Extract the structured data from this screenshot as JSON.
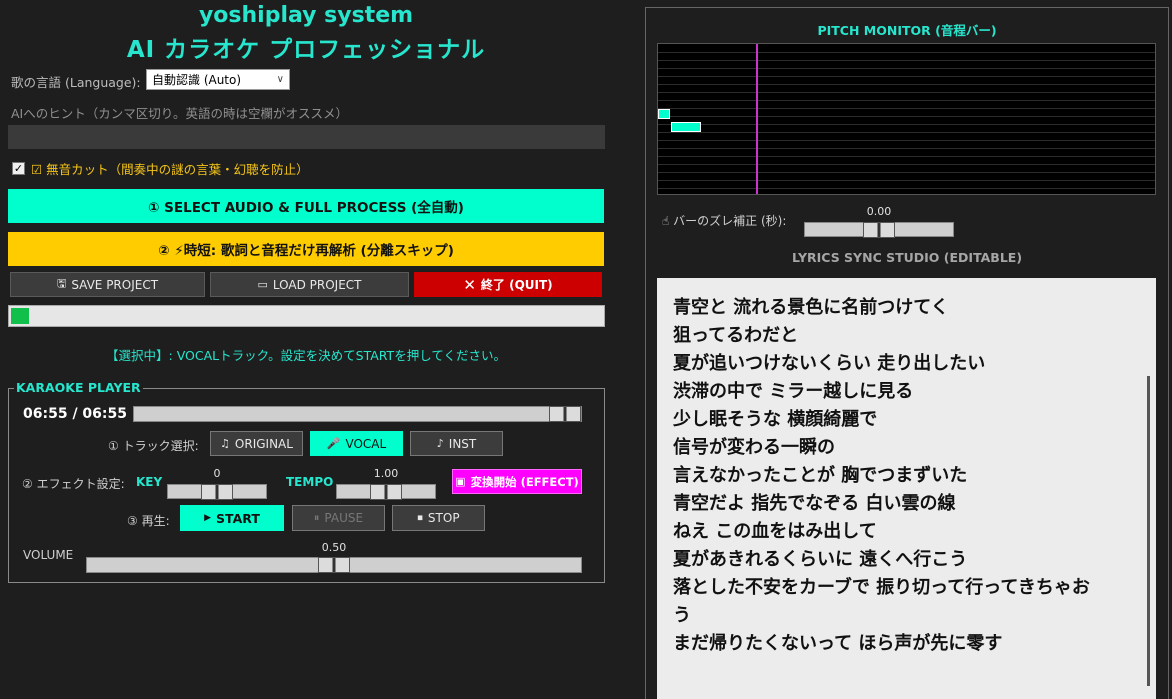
{
  "app": {
    "title_line1": "yoshiplay system",
    "title_line2": "AI カラオケ プロフェッショナル"
  },
  "settings": {
    "language_label": "歌の言語 (Language):",
    "language_value": "自動認識 (Auto)",
    "hint_label": "AIへのヒント（カンマ区切り。英語の時は空欄がオススメ）",
    "hint_value": "",
    "silence_cut_checked": true,
    "silence_cut_label": "☑ 無音カット（間奏中の謎の言葉・幻聴を防止）"
  },
  "actions": {
    "full_process": "① SELECT AUDIO & FULL PROCESS (全自動)",
    "reanalyze": "② ⚡時短: 歌詞と音程だけ再解析 (分離スキップ)",
    "save_project": "SAVE PROJECT",
    "load_project": "LOAD PROJECT",
    "quit": "終了 (QUIT)"
  },
  "progress": {
    "fraction": 0.03
  },
  "status_text": "【選択中】: VOCALトラック。設定を決めてSTARTを押してください。",
  "player": {
    "header": "KARAOKE PLAYER",
    "time_display": "06:55 / 06:55",
    "seek_fraction": 1.0,
    "track_select_label": "① トラック選択:",
    "track_original": "ORIGINAL",
    "track_vocal": "VOCAL",
    "track_inst": "INST",
    "selected_track": "VOCAL",
    "effect_label": "② エフェクト設定:",
    "key_label": "KEY",
    "key_value": "0",
    "key_fraction": 0.5,
    "tempo_label": "TEMPO",
    "tempo_value": "1.00",
    "tempo_fraction": 0.5,
    "effect_button": "変換開始 (EFFECT)",
    "play_label": "③ 再生:",
    "start": "START",
    "pause": "PAUSE",
    "stop": "STOP",
    "volume_label": "VOLUME",
    "volume_value": "0.50",
    "volume_fraction": 0.5
  },
  "pitch_monitor": {
    "title": "PITCH MONITOR (音程バー)",
    "offset_label": "バーのズレ補正 (秒):",
    "offset_value": "0.00",
    "offset_fraction": 0.5
  },
  "lyrics_studio": {
    "title": "LYRICS SYNC STUDIO (EDITABLE)",
    "lines": [
      "青空と 流れる景色に名前つけてく",
      "狙ってるわだと",
      "夏が追いつけないくらい 走り出したい",
      "渋滞の中で ミラー越しに見る",
      "少し眠そうな 横顔綺麗で",
      "信号が変わる一瞬の",
      "言えなかったことが 胸でつまずいた",
      "青空だよ 指先でなぞる 白い雲の線",
      "ねえ この血をはみ出して",
      "夏があきれるくらいに 遠くへ行こう",
      "落とした不安をカーブで 振り切って行ってきちゃお",
      "う",
      "まだ帰りたくないって ほら声が先に零す"
    ]
  },
  "colors": {
    "accent": "#27e6cd",
    "cyan_button": "#00ffcc",
    "yellow_button": "#ffcc00",
    "quit_red": "#cc0000",
    "effect_magenta": "#ff00ff",
    "progress_green": "#11c04a"
  }
}
